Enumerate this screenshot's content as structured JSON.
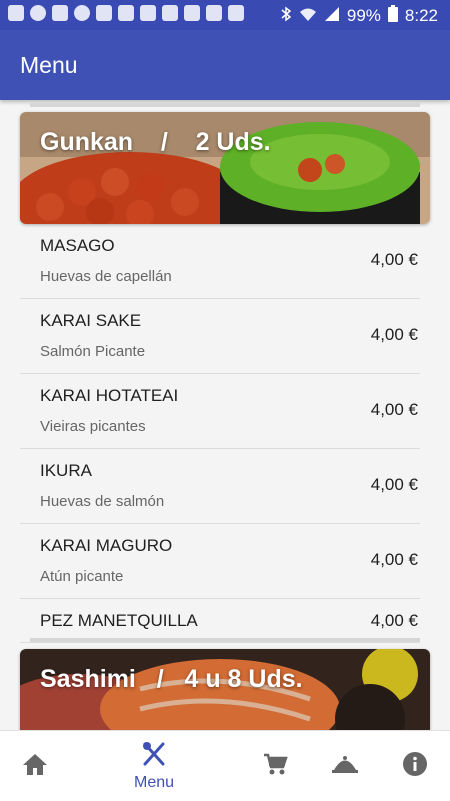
{
  "status_bar": {
    "battery": "99%",
    "time": "8:22"
  },
  "app_bar": {
    "title": "Menu"
  },
  "categories": [
    {
      "title": "Gunkan    /    2 Uds."
    },
    {
      "title": "Sashimi   /   4 u 8 Uds."
    }
  ],
  "items": [
    {
      "name": "MASAGO",
      "description": "Huevas de capellán",
      "price": "4,00 €"
    },
    {
      "name": "KARAI SAKE",
      "description": "Salmón Picante",
      "price": "4,00 €"
    },
    {
      "name": "KARAI HOTATEAI",
      "description": "Vieiras picantes",
      "price": "4,00 €"
    },
    {
      "name": "IKURA",
      "description": "Huevas de salmón",
      "price": "4,00 €"
    },
    {
      "name": "KARAI MAGURO",
      "description": "Atún picante",
      "price": "4,00 €"
    },
    {
      "name": "PEZ MANETQUILLA",
      "price": "4,00 €"
    }
  ],
  "bottom_nav": {
    "active_label": "Menu",
    "icons": [
      "home-icon",
      "menu-icon",
      "cart-icon",
      "cloche-icon",
      "info-icon"
    ]
  },
  "colors": {
    "primary": "#3f51b5",
    "status_bar": "#3a4ab3"
  }
}
